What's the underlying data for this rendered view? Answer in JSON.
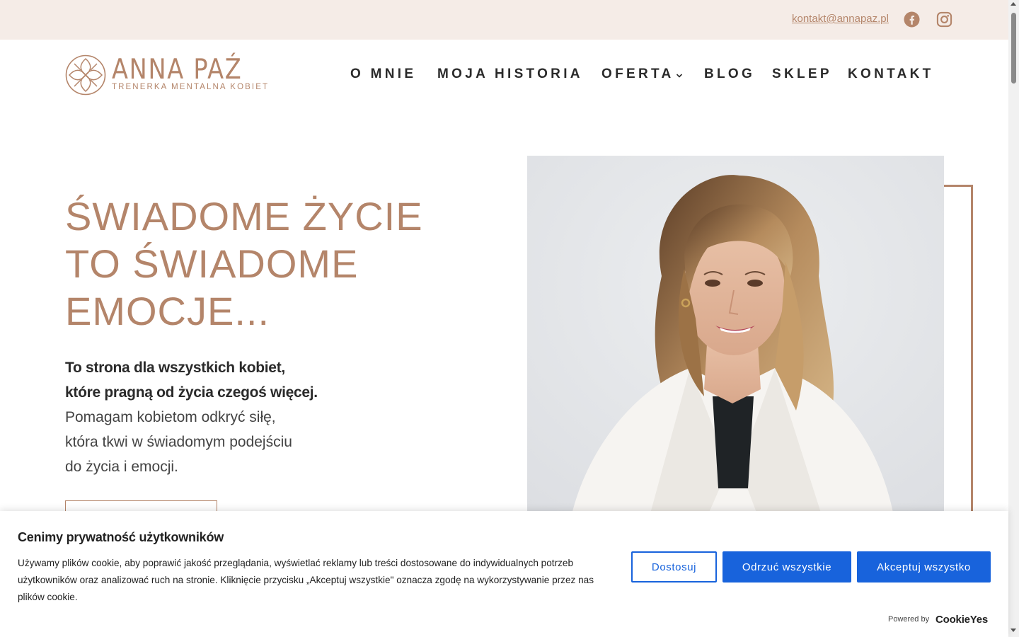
{
  "topbar": {
    "email": "kontakt@annapaz.pl",
    "icons": [
      "facebook-icon",
      "instagram-icon"
    ]
  },
  "logo": {
    "name": "ANNA PAŹ",
    "tagline": "TRENERKA MENTALNA KOBIET"
  },
  "nav": {
    "items": [
      "O MNIE",
      "MOJA HISTORIA",
      "OFERTA",
      "BLOG",
      "SKLEP",
      "KONTAKT"
    ],
    "dropdown_item": "OFERTA"
  },
  "hero": {
    "title_lines": [
      "ŚWIADOME ŻYCIE",
      "TO ŚWIADOME",
      "EMOCJE..."
    ],
    "lead_bold": [
      "To strona dla wszystkich kobiet,",
      "które pragną od życia czegoś więcej."
    ],
    "lead_regular": [
      "Pomagam kobietom odkryć siłę,",
      "która tkwi w świadomym podejściu",
      "do życia i emocji."
    ]
  },
  "cookie": {
    "title": "Cenimy prywatność użytkowników",
    "text": "Używamy plików cookie, aby poprawić jakość przeglądania, wyświetlać reklamy lub treści dostosowane do indywidualnych potrzeb użytkowników oraz analizować ruch na stronie. Kliknięcie przycisku „Akceptuj wszystkie\" oznacza zgodę na wykorzystywanie przez nas plików cookie.",
    "customize": "Dostosuj",
    "reject": "Odrzuć wszystkie",
    "accept": "Akceptuj wszystko",
    "powered_by": "Powered by",
    "brand": "CookieYes"
  },
  "colors": {
    "accent": "#b4856a",
    "topbar_bg": "#f5ece7",
    "text": "#2a2a2a",
    "cookie_blue": "#1863dc"
  }
}
